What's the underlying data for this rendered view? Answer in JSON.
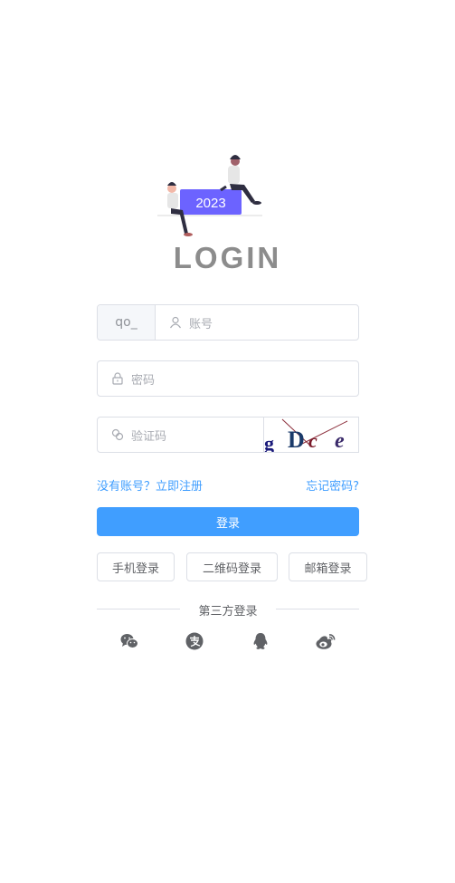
{
  "hero": {
    "badge_text": "2023"
  },
  "title": "LOGIN",
  "account": {
    "prefix": "qo_",
    "placeholder": "账号"
  },
  "password": {
    "placeholder": "密码"
  },
  "captcha": {
    "placeholder": "验证码",
    "image_text": "gDce"
  },
  "links": {
    "register": "没有账号？立即注册",
    "forgot": "忘记密码?"
  },
  "login_button": "登录",
  "alt_logins": [
    "手机登录",
    "二维码登录",
    "邮箱登录"
  ],
  "third_party": {
    "label": "第三方登录",
    "icons": [
      "wechat-icon",
      "alipay-icon",
      "qq-icon",
      "weibo-icon"
    ]
  },
  "colors": {
    "primary": "#409eff",
    "border": "#dcdfe6",
    "badge": "#6c63ff"
  }
}
